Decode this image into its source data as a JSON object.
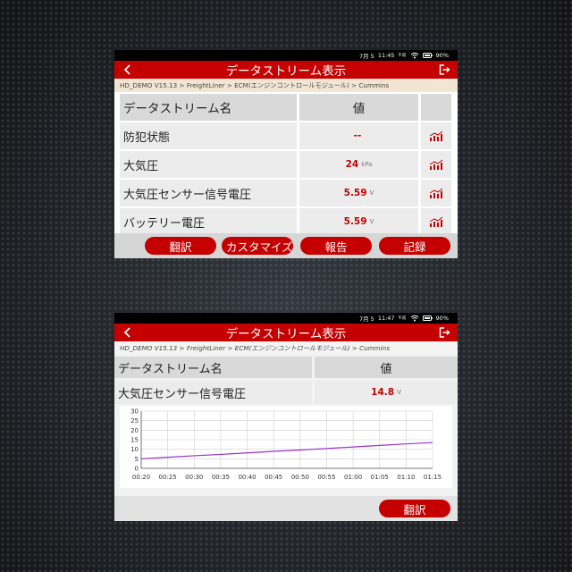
{
  "colors": {
    "accent": "#c40000",
    "header_bg": "#d9d9d9",
    "row_bg": "#ececec",
    "line": "#9b30c8"
  },
  "status": {
    "date": "7月 5",
    "time1": "11:45",
    "time2": "11:47",
    "ampm": "午前",
    "battery": "90%"
  },
  "screen1": {
    "title": "データストリーム表示",
    "breadcrumb": "HD_DEMO V15.13 > FreightLiner > ECM(エンジンコントロールモジュール) > Cummins",
    "columns": {
      "name": "データストリーム名",
      "value": "値"
    },
    "rows": [
      {
        "name": "防犯状態",
        "value": "--",
        "unit": ""
      },
      {
        "name": "大気圧",
        "value": "24",
        "unit": "kPa"
      },
      {
        "name": "大気圧センサー信号電圧",
        "value": "5.59",
        "unit": "V"
      },
      {
        "name": "バッテリー電圧",
        "value": "5.59",
        "unit": "V"
      }
    ],
    "buttons": {
      "translate": "翻訳",
      "customize": "カスタマイズ",
      "report": "報告",
      "record": "記録"
    }
  },
  "screen2": {
    "title": "データストリーム表示",
    "breadcrumb": "HD_DEMO V15.13 > FreightLiner > ECM(エンジンコントロールモジュール) > Cummins",
    "columns": {
      "name": "データストリーム名",
      "value": "値"
    },
    "selected": {
      "name": "大気圧センサー信号電圧",
      "value": "14.8",
      "unit": "V"
    },
    "button_translate": "翻訳"
  },
  "chart_data": {
    "type": "line",
    "x": [
      "00:20",
      "00:25",
      "00:30",
      "00:35",
      "00:40",
      "00:45",
      "00:50",
      "00:55",
      "01:00",
      "01:05",
      "01:10",
      "01:15"
    ],
    "ylim": [
      0,
      30
    ],
    "yticks": [
      0,
      5,
      10,
      15,
      20,
      25,
      30
    ],
    "series": [
      {
        "values": [
          5.0,
          5.8,
          6.6,
          7.3,
          8.1,
          8.9,
          9.6,
          10.4,
          11.2,
          12.0,
          12.8,
          13.5
        ]
      }
    ],
    "grid": true
  }
}
